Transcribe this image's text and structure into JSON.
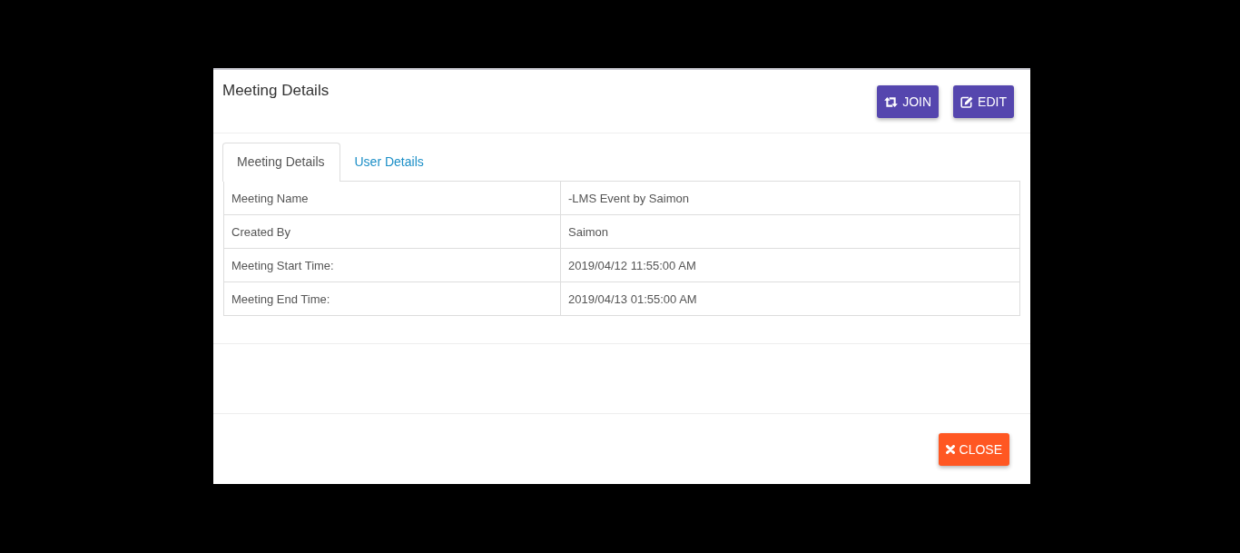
{
  "dialog": {
    "title": "Meeting Details",
    "header_buttons": [
      {
        "label": "JOIN",
        "kind": "join"
      },
      {
        "label": "EDIT",
        "kind": "edit"
      }
    ]
  },
  "tabs": [
    {
      "label": "Meeting Details",
      "selected": true
    },
    {
      "label": "User Details",
      "selected": false
    }
  ],
  "details": {
    "rows": [
      {
        "label": "Meeting Name",
        "value": "-LMS Event by Saimon"
      },
      {
        "label": "Created By",
        "value": "Saimon"
      },
      {
        "label": "Meeting Start Time:",
        "value": "2019/04/12 11:55:00 AM"
      },
      {
        "label": "Meeting End Time:",
        "value": "2019/04/13 01:55:00 AM"
      }
    ]
  },
  "footer": {
    "close_button": {
      "label": "CLOSE"
    }
  }
}
